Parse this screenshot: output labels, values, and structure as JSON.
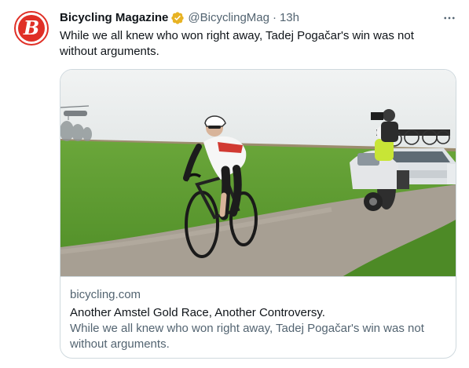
{
  "author": {
    "name": "Bicycling Magazine",
    "handle": "@BicyclingMag",
    "time": "13h",
    "avatar_letter": "B",
    "brand_color": "#e02f26",
    "verified_color": "#e8b324"
  },
  "tweet": {
    "text": "While we all knew who won right away, Tadej Pogačar's win was not without arguments."
  },
  "card": {
    "domain": "bicycling.com",
    "title": "Another Amstel Gold Race, Another Controversy.",
    "description": "While we all knew who won right away, Tadej Pogačar's win was not without arguments.",
    "image_label": "rider-on-road-photo"
  },
  "icons": {
    "more": "more-horizontal-icon",
    "verified": "verified-badge-icon"
  }
}
